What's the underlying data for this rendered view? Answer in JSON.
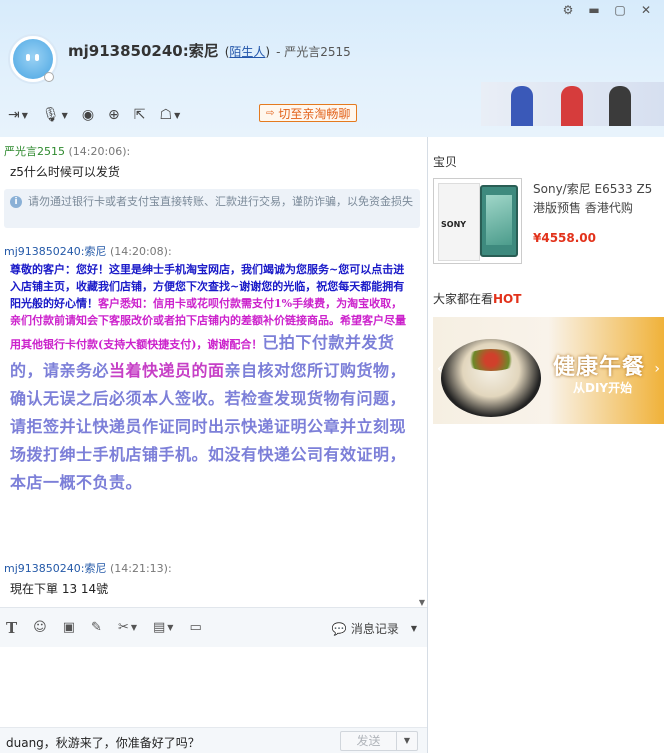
{
  "header": {
    "contact_name": "mj913850240:索尼",
    "relation_label": "陌生人",
    "relation_prefix": "(",
    "relation_suffix": ")",
    "extra": "- 严光言2515",
    "switch_button": "切至亲淘畅聊"
  },
  "chat": {
    "messages": [
      {
        "sender": "严光言2515",
        "time": "(14:20:06):",
        "text": "z5什么时候可以发货"
      },
      {
        "sender": "mj913850240:索尼",
        "time": "(14:20:08):"
      },
      {
        "sender": "mj913850240:索尼",
        "time": "(14:21:13):",
        "text": "現在下單 13 14號"
      }
    ],
    "notice": "请勿通过银行卡或者支付宝直接转账、汇款进行交易，谨防诈骗，以免资金损失",
    "shop_blue_1": "尊敬的客户：您好！这里是绅士手机淘宝网店，我们竭诚为您服务~您可以点击进入店铺主页，收藏我们店铺，方便您下次查找~谢谢您的光临，祝您每天都能拥有阳光般的好心情！",
    "shop_magenta_1": "客户悉知：信用卡或花呗付款需支付1%手续费，为淘宝收取，亲们付款前请知会下客服改价或者拍下店铺内的差额补价链接商品。希望客户尽量用其他银行卡付款(支持大额快捷支付)，谢谢配合！",
    "shop_big_1": "已拍下付款并发货的，请亲务必",
    "shop_big_hl": "当着快递员的面",
    "shop_big_2": "亲自核对您所订购货物，确认无误之后必须本人签收。若检查发现货物有问题，请拒签并让快递员作证同时出示快递证明公章并立刻现场拨打绅士手机店铺手机。如没有快递公司有效证明，本店一概不负责。"
  },
  "input": {
    "history_label": "消息记录",
    "bottom_text": "duang，秋游来了，你准备好了吗？",
    "send_label": "发送"
  },
  "right": {
    "product_section": "宝贝",
    "product_name": "Sony/索尼 E6533 Z5港版预售 香港代购",
    "product_price": "¥4558.00",
    "box_label": "SONY",
    "hot_section": "大家都在看",
    "hot_tag": "HOT",
    "ad_title": "健康午餐",
    "ad_sub": "从DIY开始"
  },
  "icons": [
    "settings-icon",
    "minimize-icon",
    "maximize-icon",
    "close-icon",
    "transfer-file-icon",
    "microphone-icon",
    "video-call-icon",
    "add-contact-icon",
    "screen-share-icon",
    "remote-assist-icon",
    "font-icon",
    "emoji-icon",
    "image-icon",
    "edit-icon",
    "scissors-icon",
    "table-icon",
    "history-icon"
  ]
}
